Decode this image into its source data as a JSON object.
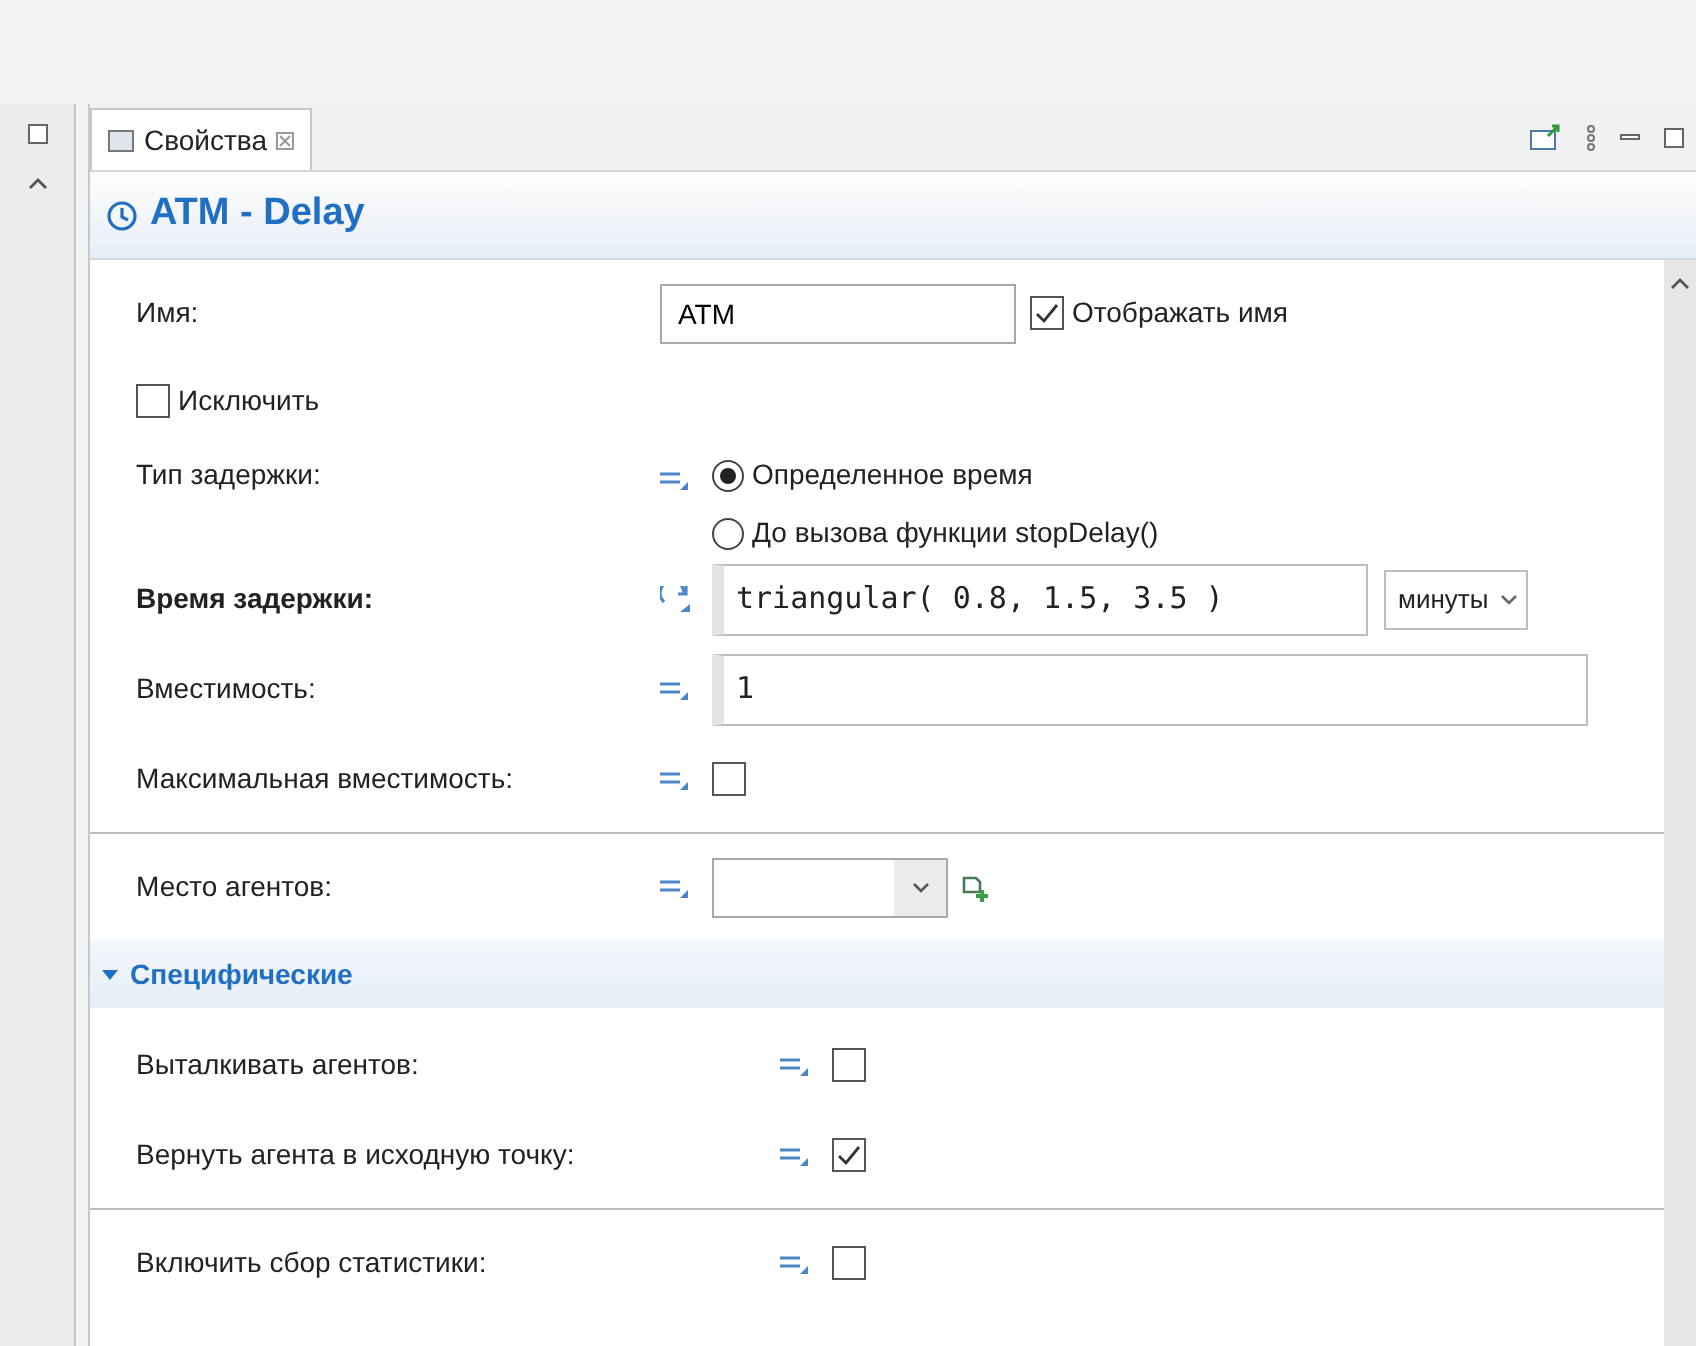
{
  "tab": {
    "label": "Свойства"
  },
  "title": "ATM - Delay",
  "rows": [
    {
      "kind": "name",
      "label": "Имя:",
      "value": "ATM",
      "option": {
        "label": "Отображать имя",
        "checked": true
      }
    },
    {
      "kind": "flag",
      "label": "Исключить",
      "checked": false
    },
    {
      "kind": "radio",
      "label": "Тип задержки:",
      "dynamic": false,
      "options": [
        {
          "label": "Определенное время",
          "selected": true
        },
        {
          "label": "До вызова функции stopDelay()",
          "selected": false
        }
      ]
    },
    {
      "kind": "code",
      "label": "Время задержки:",
      "bold": true,
      "dynamic": true,
      "value": "triangular( 0.8, 1.5, 3.5 )",
      "unit": "минуты"
    },
    {
      "kind": "code",
      "label": "Вместимость:",
      "bold": false,
      "dynamic": false,
      "value": "1"
    },
    {
      "kind": "check",
      "label": "Максимальная вместимость:",
      "dynamic": false,
      "checked": false
    },
    {
      "kind": "select",
      "label": "Место агентов:",
      "dynamic": false,
      "separator_before": true
    }
  ],
  "sections": [
    {
      "title": "Специфические",
      "expanded": true,
      "rows": [
        {
          "kind": "check",
          "label": "Выталкивать агентов:",
          "dynamic": false,
          "checked": false
        },
        {
          "kind": "check",
          "label": "Вернуть агента в исходную точку:",
          "dynamic": false,
          "checked": true
        },
        {
          "kind": "check",
          "label": "Включить сбор статистики:",
          "dynamic": false,
          "checked": false,
          "separator_before": true
        }
      ]
    }
  ]
}
